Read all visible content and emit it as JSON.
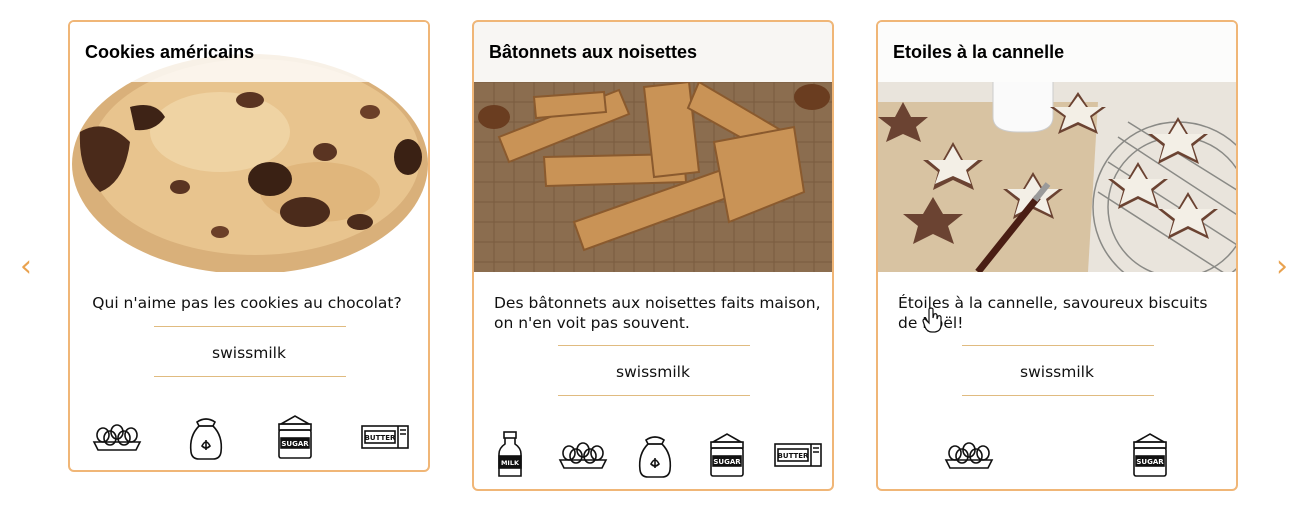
{
  "nav": {
    "prev": "‹",
    "next": "›"
  },
  "cards": [
    {
      "title": "Cookies américains",
      "description": "Qui n'aime pas les cookies au chocolat?",
      "source": "swissmilk",
      "ingredients": [
        "eggs",
        "flour",
        "sugar",
        "butter"
      ]
    },
    {
      "title": "Bâtonnets aux noisettes",
      "description": "Des bâtonnets aux noisettes faits maison, on n'en voit pas souvent.",
      "source": "swissmilk",
      "ingredients": [
        "milk",
        "eggs",
        "flour",
        "sugar",
        "butter"
      ]
    },
    {
      "title": "Etoiles à la cannelle",
      "description": "Étoiles à la cannelle, savoureux biscuits de Noël!",
      "source": "swissmilk",
      "ingredients": [
        "eggs",
        "sugar"
      ]
    }
  ],
  "icon_labels": {
    "sugar": "SUGAR",
    "butter": "BUTTER",
    "milk": "MILK"
  },
  "colors": {
    "accent": "#e9a24f",
    "card_border": "#f0b677",
    "rule": "#e0bb80"
  }
}
